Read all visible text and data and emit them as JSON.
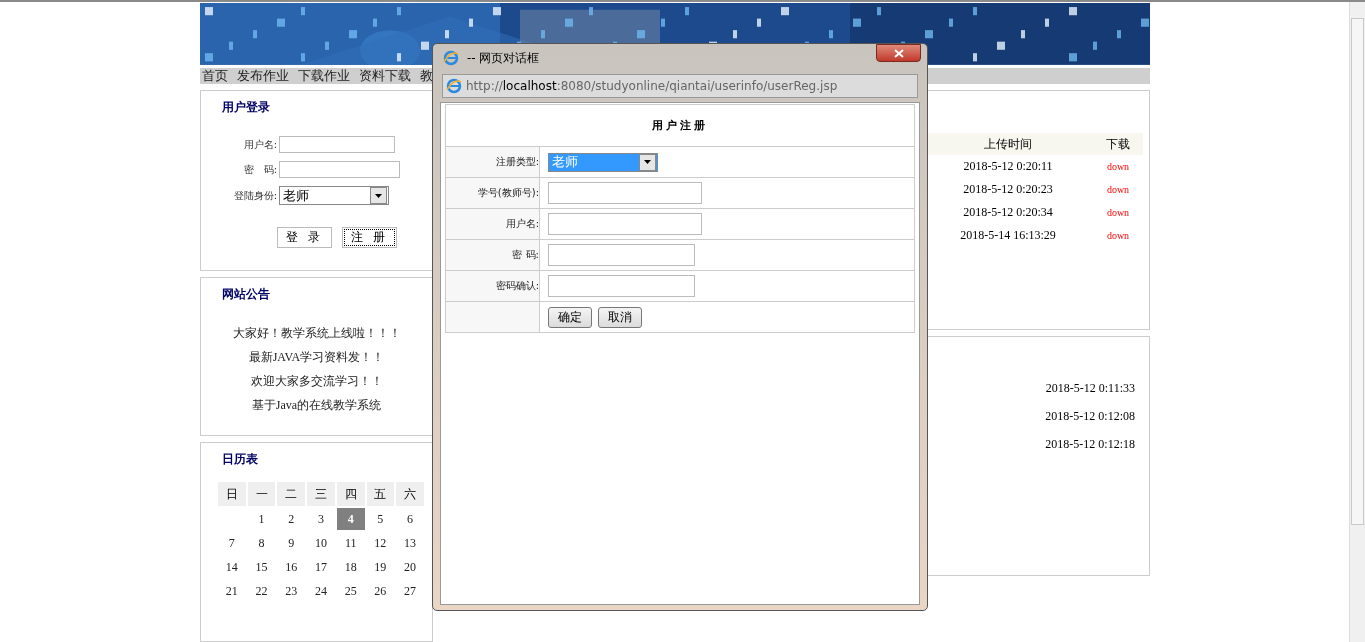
{
  "nav": {
    "items": [
      {
        "label": "首页"
      },
      {
        "label": "发布作业"
      },
      {
        "label": "下载作业"
      },
      {
        "label": "资料下载"
      },
      {
        "label": "教"
      }
    ]
  },
  "login": {
    "title": "用户登录",
    "fields": [
      {
        "label": "用户名:",
        "kind": "text"
      },
      {
        "label": "密　码:",
        "kind": "password"
      },
      {
        "label": "登陆身份:",
        "kind": "select",
        "value": "老师"
      }
    ],
    "buttons": [
      {
        "label": "登 录",
        "focused": false
      },
      {
        "label": "注 册",
        "focused": true
      }
    ]
  },
  "notice": {
    "title": "网站公告",
    "lines": [
      "大家好！教学系统上线啦！！！",
      "最新JAVA学习资料发！！",
      "欢迎大家多交流学习！！",
      "基于Java的在线教学系统"
    ]
  },
  "calendar": {
    "title": "日历表",
    "weekdays": [
      "日",
      "一",
      "二",
      "三",
      "四",
      "五",
      "六"
    ],
    "weeks": [
      [
        {
          "day": "1",
          "selected": false
        },
        {
          "day": "2",
          "selected": false
        },
        {
          "day": "3",
          "selected": false
        },
        {
          "day": "4",
          "selected": true
        },
        {
          "day": "5",
          "selected": false
        },
        {
          "day": "6",
          "selected": false
        }
      ],
      [
        {
          "day": "7",
          "selected": false
        },
        {
          "day": "8",
          "selected": false
        },
        {
          "day": "9",
          "selected": false
        },
        {
          "day": "10",
          "selected": false
        },
        {
          "day": "11",
          "selected": false
        },
        {
          "day": "12",
          "selected": false
        },
        {
          "day": "13",
          "selected": false
        }
      ],
      [
        {
          "day": "14",
          "selected": false
        },
        {
          "day": "15",
          "selected": false
        },
        {
          "day": "16",
          "selected": false
        },
        {
          "day": "17",
          "selected": false
        },
        {
          "day": "18",
          "selected": false
        },
        {
          "day": "19",
          "selected": false
        },
        {
          "day": "20",
          "selected": false
        }
      ],
      [
        {
          "day": "21",
          "selected": false
        },
        {
          "day": "22",
          "selected": false
        },
        {
          "day": "23",
          "selected": false
        },
        {
          "day": "24",
          "selected": false
        },
        {
          "day": "25",
          "selected": false
        },
        {
          "day": "26",
          "selected": false
        },
        {
          "day": "27",
          "selected": false
        }
      ]
    ]
  },
  "files": {
    "columns": [
      "上传时间",
      "下载"
    ],
    "rows": [
      {
        "time": "2018-5-12 0:20:11",
        "link": "down"
      },
      {
        "time": "2018-5-12 0:20:23",
        "link": "down"
      },
      {
        "time": "2018-5-12 0:20:34",
        "link": "down"
      },
      {
        "time": "2018-5-14 16:13:29",
        "link": "down"
      }
    ]
  },
  "news": {
    "rows": [
      "2018-5-12 0:11:33",
      "2018-5-12 0:12:08",
      "2018-5-12 0:12:18"
    ]
  },
  "dialog": {
    "title": "-- 网页对话框",
    "url": "http://**localhost**:8080/studyonline/qiantai/userinfo/userReg.jsp",
    "form_title": "用户注册",
    "rows": [
      {
        "label": "注册类型:",
        "kind": "select",
        "value": "老师",
        "selected": true
      },
      {
        "label": "学号(教师号):",
        "kind": "text"
      },
      {
        "label": "用户名:",
        "kind": "text"
      },
      {
        "label": "密 码:",
        "kind": "password"
      },
      {
        "label": "密码确认:",
        "kind": "password"
      }
    ],
    "buttons": [
      "确定",
      "取消"
    ]
  }
}
